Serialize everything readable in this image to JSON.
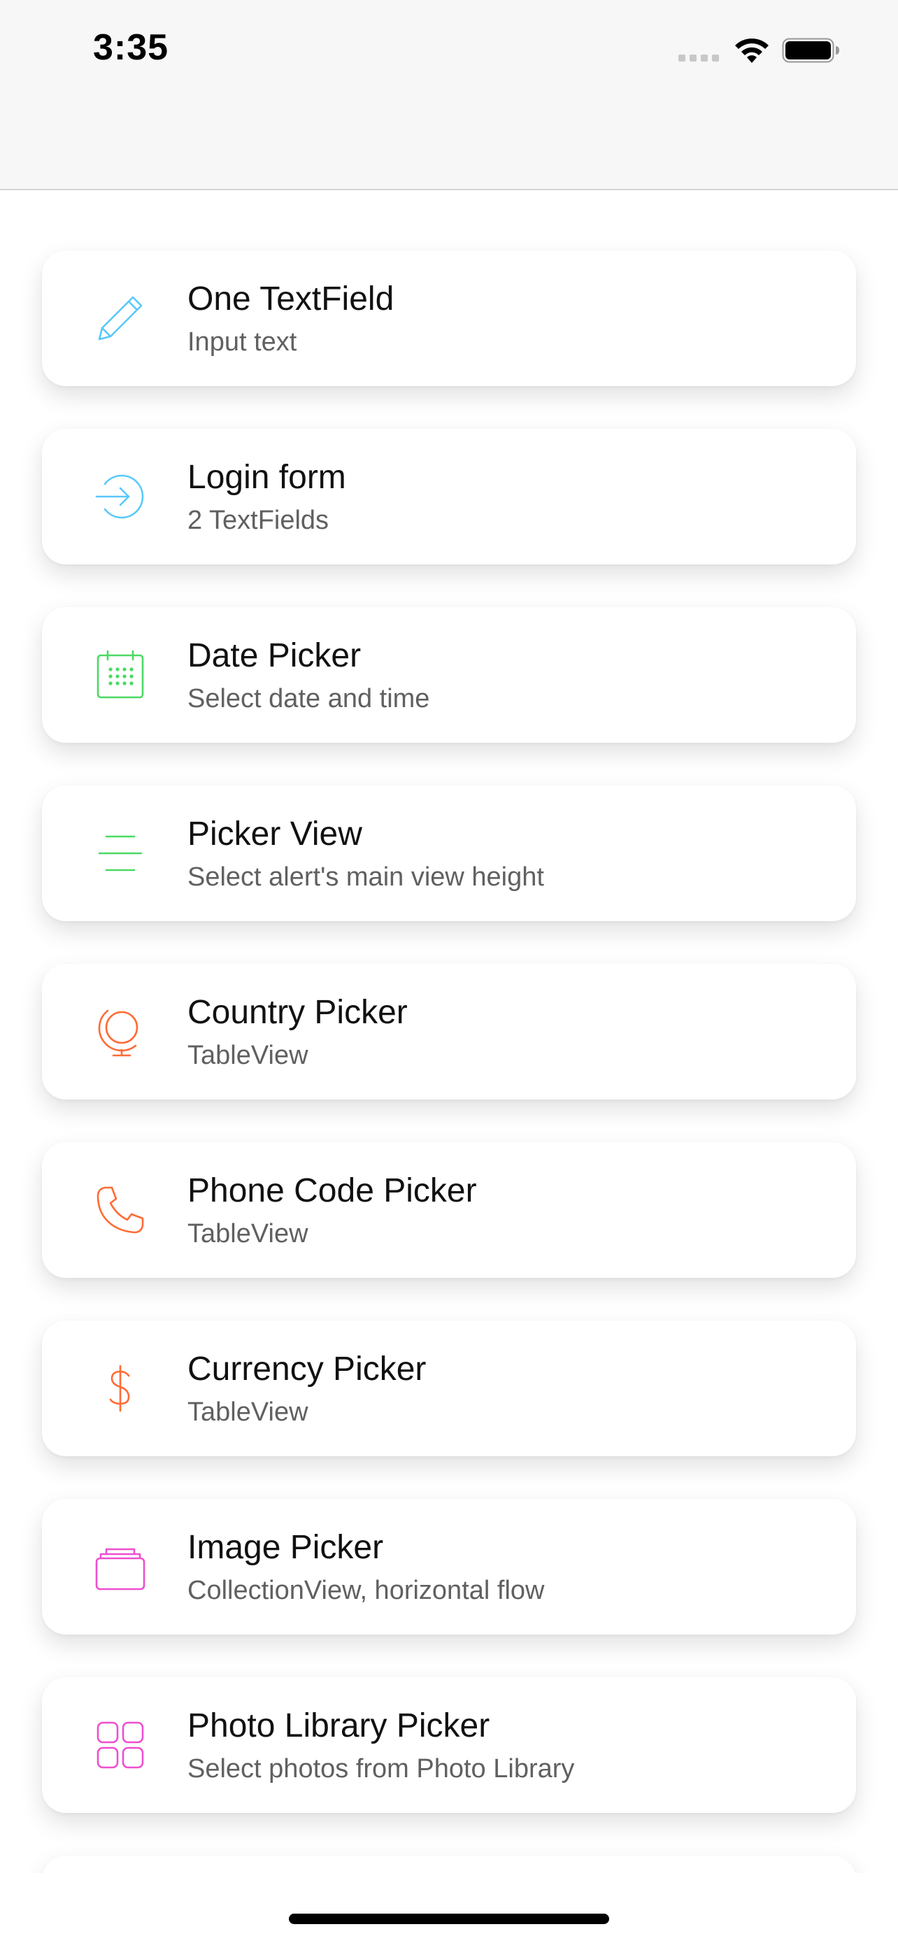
{
  "status_bar": {
    "time": "3:35"
  },
  "colors": {
    "blue": "#5ac8fa",
    "green": "#4cd964",
    "orange": "#ff6b35",
    "pink": "#ee4fd0"
  },
  "items": [
    {
      "title": "One TextField",
      "subtitle": "Input text",
      "icon": "pencil-icon"
    },
    {
      "title": "Login form",
      "subtitle": "2 TextFields",
      "icon": "login-icon"
    },
    {
      "title": "Date Picker",
      "subtitle": "Select date and time",
      "icon": "calendar-icon"
    },
    {
      "title": "Picker View",
      "subtitle": "Select alert's main view height",
      "icon": "lines-icon"
    },
    {
      "title": "Country Picker",
      "subtitle": "TableView",
      "icon": "globe-icon"
    },
    {
      "title": "Phone Code Picker",
      "subtitle": "TableView",
      "icon": "phone-icon"
    },
    {
      "title": "Currency Picker",
      "subtitle": "TableView",
      "icon": "dollar-icon"
    },
    {
      "title": "Image Picker",
      "subtitle": "CollectionView, horizontal flow",
      "icon": "image-stack-icon"
    },
    {
      "title": "Photo Library Picker",
      "subtitle": "Select photos from Photo Library",
      "icon": "grid-icon"
    }
  ]
}
